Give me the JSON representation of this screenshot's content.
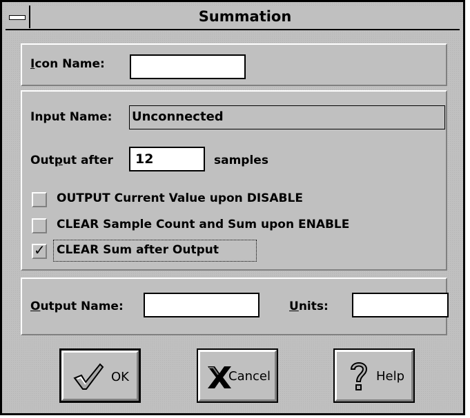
{
  "window": {
    "title": "Summation"
  },
  "icon_name": {
    "label_u": "I",
    "label_rest": "con Name:",
    "value": ""
  },
  "input_name": {
    "label": "Input Name:",
    "value": "Unconnected"
  },
  "output_after": {
    "label_pre": "Out",
    "label_u": "p",
    "label_post": "ut after",
    "value": "12",
    "suffix": "samples"
  },
  "options": [
    {
      "label": "OUTPUT Current Value upon DISABLE",
      "checked": false
    },
    {
      "label": "CLEAR Sample Count and Sum upon ENABLE",
      "checked": false
    },
    {
      "label": "CLEAR Sum after Output",
      "checked": true,
      "check_glyph": "✓"
    }
  ],
  "output_name": {
    "label_u": "O",
    "label_rest": "utput Name:",
    "value": ""
  },
  "units": {
    "label_u": "U",
    "label_rest": "nits:",
    "value": ""
  },
  "buttons": {
    "ok": {
      "label": "OK",
      "icon": "checkmark-icon"
    },
    "cancel": {
      "label": "Cancel",
      "icon": "x-icon"
    },
    "help": {
      "label": "Help",
      "icon": "question-icon"
    }
  }
}
